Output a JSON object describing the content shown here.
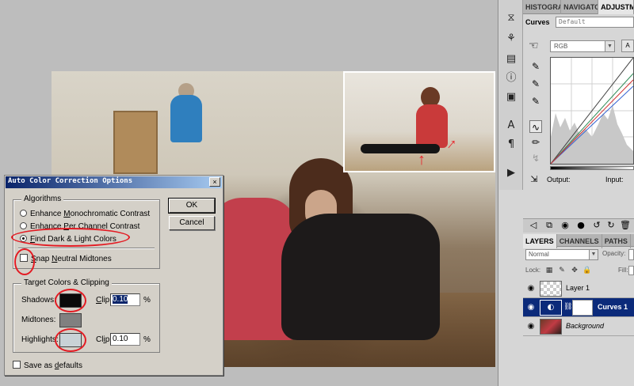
{
  "dialog": {
    "title": "Auto Color Correction Options",
    "close": "×",
    "algorithms": {
      "legend": "Algorithms",
      "options": [
        {
          "pre": "Enhance ",
          "u": "M",
          "post": "onochromatic Contrast",
          "checked": false
        },
        {
          "pre": "Enhance ",
          "u": "P",
          "post": "er Channel Contrast",
          "checked": false
        },
        {
          "pre": "",
          "u": "F",
          "post": "ind Dark & Light Colors",
          "checked": true
        }
      ],
      "snap": {
        "pre": "",
        "u": "S",
        "mid": "nap ",
        "u2": "N",
        "post": "eutral Midtones",
        "checked": false
      }
    },
    "buttons": {
      "ok": "OK",
      "cancel": "Cancel"
    },
    "target": {
      "legend": "Target Colors & Clipping",
      "shadows": {
        "label": "Shadows:",
        "color": "#0a0a0a",
        "clip_label": "Clip:",
        "clip": "0.10",
        "pct": "%"
      },
      "midtones": {
        "label": "Midtones:",
        "color": "#808080"
      },
      "highlights": {
        "label": "Highlights:",
        "color": "#c9d2d6",
        "clip_label": "Clip:",
        "clip": "0.10",
        "pct": "%"
      }
    },
    "save_defaults": {
      "pre": "Save as ",
      "u": "d",
      "post": "efaults",
      "checked": false
    }
  },
  "adjust_panel": {
    "tabs": [
      "HISTOGRA",
      "NAVIGATO",
      "ADJUSTM"
    ],
    "curves_title": "Curves",
    "preset": "Default",
    "channel": "RGB",
    "auto": "A",
    "output_label": "Output:",
    "input_label": "Input:"
  },
  "layers_panel": {
    "tabs": [
      "LAYERS",
      "CHANNELS",
      "PATHS"
    ],
    "blend_mode": "Normal",
    "opacity_label": "Opacity:",
    "lock_label": "Lock:",
    "fill_label": "Fill:",
    "layers": [
      {
        "name": "Layer 1",
        "selected": false
      },
      {
        "name": "Curves 1",
        "selected": true
      },
      {
        "name": "Background",
        "selected": false
      }
    ]
  },
  "icons": {
    "hand": "pointing-hand-icon",
    "eye": "eye-icon",
    "chain": "chain-link-icon",
    "dropper": "eyedropper-icon"
  },
  "colors": {
    "accent": "#0b2a7a",
    "annotation": "#e31b23",
    "title_start": "#0a246a",
    "title_end": "#a6caf0"
  }
}
